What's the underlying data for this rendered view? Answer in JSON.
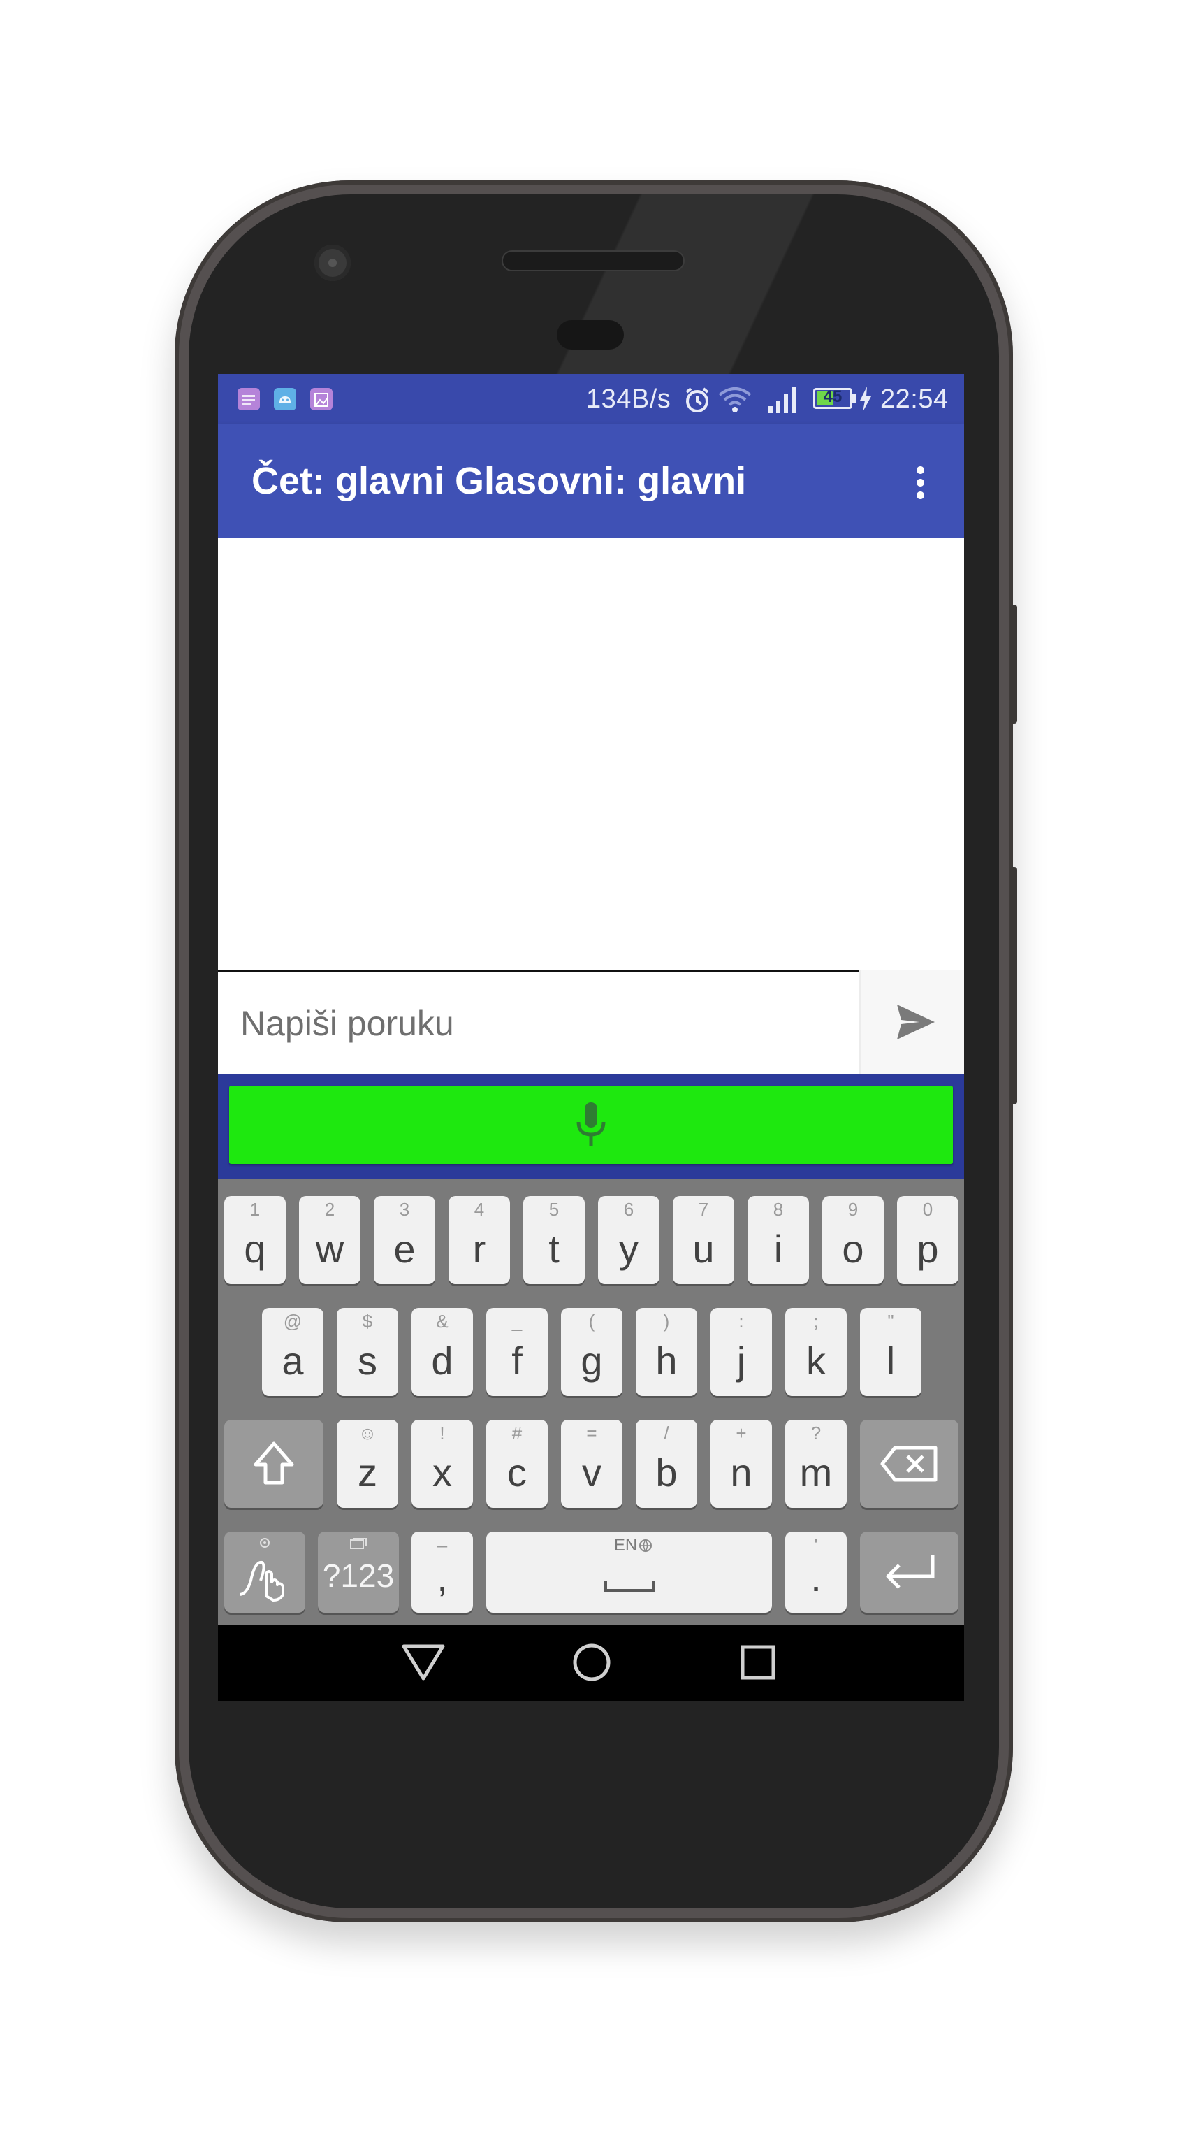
{
  "status_bar": {
    "speed": "134B/s",
    "battery": "45",
    "time": "22:54"
  },
  "app_bar": {
    "title": "Čet: glavni Glasovni: glavni"
  },
  "composer": {
    "placeholder": "Napiši poruku",
    "value": ""
  },
  "keyboard": {
    "row1": [
      {
        "key": "q",
        "hint": "1"
      },
      {
        "key": "w",
        "hint": "2"
      },
      {
        "key": "e",
        "hint": "3"
      },
      {
        "key": "r",
        "hint": "4"
      },
      {
        "key": "t",
        "hint": "5"
      },
      {
        "key": "y",
        "hint": "6"
      },
      {
        "key": "u",
        "hint": "7"
      },
      {
        "key": "i",
        "hint": "8"
      },
      {
        "key": "o",
        "hint": "9"
      },
      {
        "key": "p",
        "hint": "0"
      }
    ],
    "row2": [
      {
        "key": "a",
        "hint": "@"
      },
      {
        "key": "s",
        "hint": "$"
      },
      {
        "key": "d",
        "hint": "&"
      },
      {
        "key": "f",
        "hint": "_"
      },
      {
        "key": "g",
        "hint": "("
      },
      {
        "key": "h",
        "hint": ")"
      },
      {
        "key": "j",
        "hint": ":"
      },
      {
        "key": "k",
        "hint": ";"
      },
      {
        "key": "l",
        "hint": "\""
      }
    ],
    "row3": [
      {
        "key": "z",
        "hint": "☺"
      },
      {
        "key": "x",
        "hint": "!"
      },
      {
        "key": "c",
        "hint": "#"
      },
      {
        "key": "v",
        "hint": "="
      },
      {
        "key": "b",
        "hint": "/"
      },
      {
        "key": "n",
        "hint": "+"
      },
      {
        "key": "m",
        "hint": "?"
      }
    ],
    "symbols_label": "?123",
    "comma": {
      "key": ",",
      "hint": "–"
    },
    "period": {
      "key": ".",
      "hint": "'"
    },
    "space_label": "EN"
  },
  "colors": {
    "status_bar": "#3949ab",
    "app_bar": "#3f51b5",
    "mic_button": "#1ee80f",
    "mic_icon": "#2e7d32",
    "keyboard_bg": "#7a7a7a"
  },
  "icons": {
    "status_left": [
      "notification-icon",
      "android-icon",
      "image-icon"
    ],
    "status_right": [
      "alarm-icon",
      "wifi-icon",
      "signal-icon",
      "battery-icon",
      "charging-icon"
    ],
    "app_bar": "more-vert-icon",
    "send": "send-icon",
    "mic": "mic-icon",
    "keyboard": [
      "shift-icon",
      "backspace-icon",
      "gesture-icon",
      "language-icon",
      "enter-icon"
    ],
    "nav": [
      "back-icon",
      "home-icon",
      "recents-icon"
    ]
  }
}
